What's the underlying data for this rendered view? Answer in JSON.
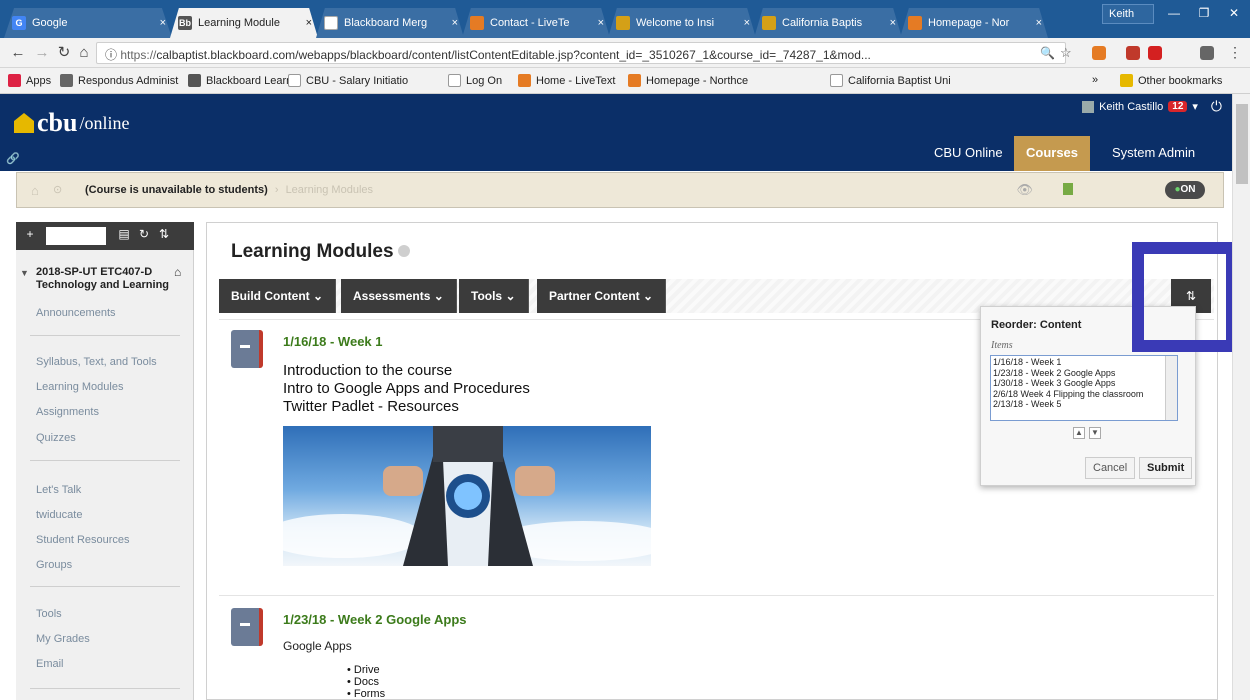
{
  "browser": {
    "tabs": [
      {
        "label": "Google",
        "icon": "google-icon",
        "color": "#4285f4"
      },
      {
        "label": "Learning Module",
        "icon": "blackboard-icon",
        "color": "#555"
      },
      {
        "label": "Blackboard Merg",
        "icon": "doc-icon",
        "color": "#aaa"
      },
      {
        "label": "Contact - LiveTe",
        "icon": "livetext-icon",
        "color": "#e57b24"
      },
      {
        "label": "Welcome to Insi",
        "icon": "insight-icon",
        "color": "#d4a017"
      },
      {
        "label": "California Baptis",
        "icon": "cbu-icon",
        "color": "#d4a017"
      },
      {
        "label": "Homepage - Nor",
        "icon": "northcentral-icon",
        "color": "#e57b24"
      }
    ],
    "profile": "Keith",
    "url_scheme": "https://",
    "url_rest": "calbaptist.blackboard.com/webapps/blackboard/content/listContentEditable.jsp?content_id=_3510267_1&course_id=_74287_1&mod...",
    "bookmarks": [
      {
        "label": "Apps"
      },
      {
        "label": "Respondus Administ"
      },
      {
        "label": "Blackboard Learn"
      },
      {
        "label": "CBU - Salary Initiatio"
      },
      {
        "label": "Log On"
      },
      {
        "label": "Home - LiveText"
      },
      {
        "label": "Homepage - Northce"
      },
      {
        "label": "California Baptist Uni"
      }
    ],
    "other_bookmarks": "Other bookmarks"
  },
  "header": {
    "logo_main": "cbu",
    "logo_sub": "/online",
    "user_name": "Keith Castillo",
    "notifications": "12",
    "tabs": [
      "CBU Online",
      "Courses",
      "System Admin"
    ],
    "active_tab": "Courses"
  },
  "breadcrumb": {
    "status": "(Course is unavailable to students)",
    "separator": "›",
    "current": "Learning Modules",
    "edit_mode": "ON"
  },
  "sidebar": {
    "course_code": "2018-SP-UT ETC407-D",
    "course_name": "Technology and Learning",
    "groups": [
      [
        "Announcements"
      ],
      [
        "Syllabus, Text, and Tools",
        "Learning Modules",
        "Assignments",
        "Quizzes"
      ],
      [
        "Let's Talk",
        "twiducate",
        "Student Resources",
        "Groups"
      ],
      [
        "Tools",
        "My Grades",
        "Email"
      ]
    ]
  },
  "main": {
    "title": "Learning Modules",
    "actions": [
      "Build Content",
      "Assessments",
      "Tools",
      "Partner Content"
    ],
    "items": [
      {
        "title": "1/16/18 - Week 1",
        "lines": [
          "Introduction to the course",
          "Intro to Google Apps and Procedures",
          "Twitter Padlet - Resources"
        ]
      },
      {
        "title": "1/23/18 - Week 2 Google Apps",
        "lines": [
          "Google Apps"
        ],
        "bullets": [
          "Drive",
          "Docs",
          "Forms"
        ]
      }
    ]
  },
  "reorder": {
    "title": "Reorder: Content",
    "label": "Items",
    "items": [
      "1/16/18 - Week 1",
      "1/23/18 - Week 2 Google Apps",
      "1/30/18 - Week 3 Google Apps",
      "2/6/18 Week 4 Flipping the classroom",
      "2/13/18 - Week 5"
    ],
    "cancel": "Cancel",
    "submit": "Submit"
  },
  "colors": {
    "header": "#0b2f68",
    "accent": "#c59a4f",
    "item_title": "#3c7b1b",
    "highlight": "#3a3ab6"
  }
}
